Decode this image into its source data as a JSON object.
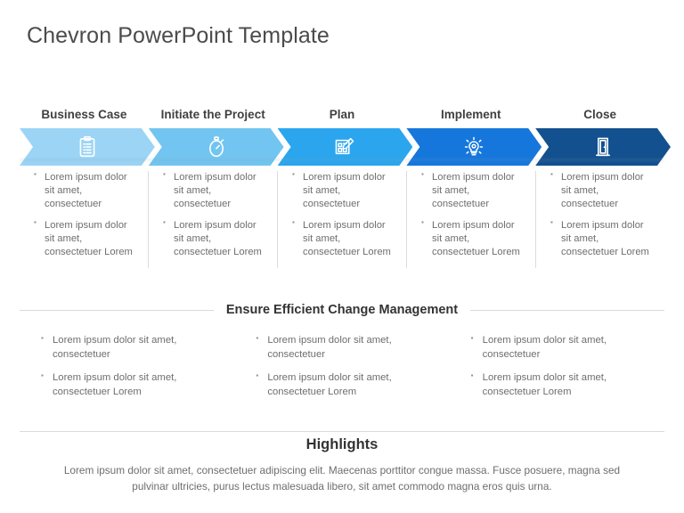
{
  "slide": {
    "title": "Chevron PowerPoint Template"
  },
  "process": {
    "steps": [
      {
        "label": "Business Case",
        "icon": "clipboard-icon",
        "color": "#9BD4F5",
        "bullets": [
          "Lorem ipsum dolor sit amet, consectetuer",
          "Lorem ipsum dolor sit amet, consectetuer Lorem"
        ]
      },
      {
        "label": "Initiate the Project",
        "icon": "stopwatch-icon",
        "color": "#71C5F0",
        "bullets": [
          "Lorem ipsum dolor sit amet, consectetuer",
          "Lorem ipsum dolor sit amet, consectetuer Lorem"
        ]
      },
      {
        "label": "Plan",
        "icon": "blueprint-icon",
        "color": "#2BA6EE",
        "bullets": [
          "Lorem ipsum dolor sit amet, consectetuer",
          "Lorem ipsum dolor sit amet, consectetuer Lorem"
        ]
      },
      {
        "label": "Implement",
        "icon": "lightbulb-icon",
        "color": "#1577DC",
        "bullets": [
          "Lorem ipsum dolor sit amet, consectetuer",
          "Lorem ipsum dolor sit amet, consectetuer Lorem"
        ]
      },
      {
        "label": "Close",
        "icon": "door-icon",
        "color": "#13508F",
        "bullets": [
          "Lorem ipsum dolor sit amet, consectetuer",
          "Lorem ipsum dolor sit amet, consectetuer Lorem"
        ]
      }
    ]
  },
  "change_management": {
    "heading": "Ensure Efficient Change Management",
    "columns": [
      {
        "bullets": [
          "Lorem ipsum dolor sit amet, consectetuer",
          "Lorem ipsum dolor sit amet, consectetuer Lorem"
        ]
      },
      {
        "bullets": [
          "Lorem ipsum dolor sit amet, consectetuer",
          "Lorem ipsum dolor sit amet, consectetuer Lorem"
        ]
      },
      {
        "bullets": [
          "Lorem ipsum dolor sit amet, consectetuer",
          "Lorem ipsum dolor sit amet, consectetuer Lorem"
        ]
      }
    ]
  },
  "highlights": {
    "heading": "Highlights",
    "body": "Lorem ipsum dolor sit amet, consectetuer adipiscing elit. Maecenas porttitor congue massa. Fusce posuere, magna sed pulvinar ultricies, purus lectus malesuada libero, sit amet commodo magna eros quis urna."
  }
}
